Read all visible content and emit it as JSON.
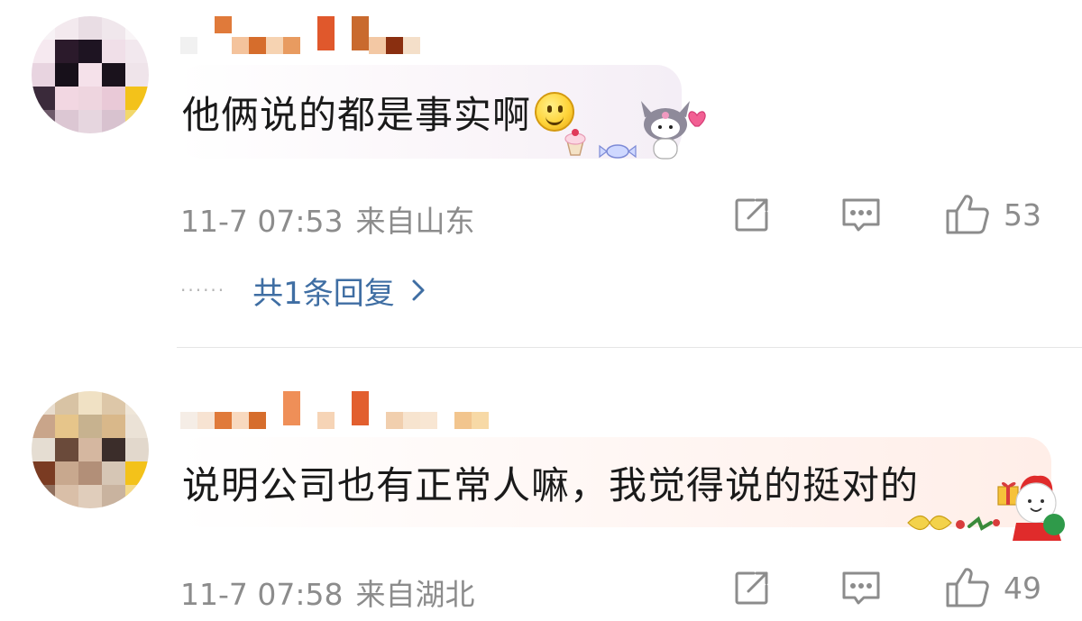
{
  "comments": [
    {
      "text": "他俩说的都是事实啊",
      "emoji": "smile-emoji",
      "sticker": "kuromi-sticker",
      "time": "11-7 07:53",
      "location": "来自山东",
      "likes": "53",
      "replies_label": "共1条回复",
      "replies_prefix": "······"
    },
    {
      "text": "说明公司也有正常人嘛，我觉得说的挺对的",
      "sticker": "christmas-sticker",
      "time": "11-7 07:58",
      "location": "来自湖北",
      "likes": "49"
    }
  ],
  "colors": {
    "meta_gray": "#8c8c8c",
    "link_blue": "#3f6ea3",
    "icon_gray": "#8c8c8c"
  },
  "icons": [
    "share-icon",
    "comment-icon",
    "like-icon",
    "chevron-right-icon"
  ]
}
